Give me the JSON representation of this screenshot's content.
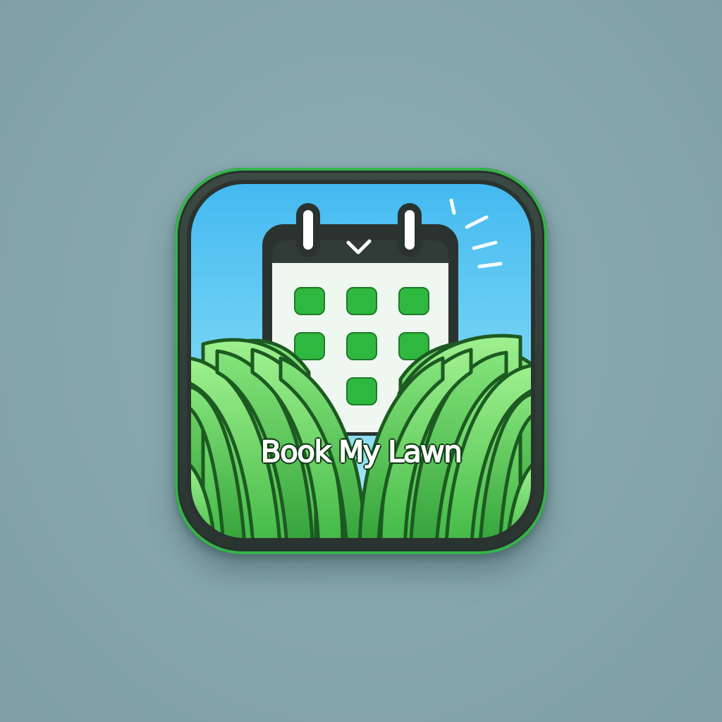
{
  "app": {
    "name": "Book My Lawn"
  },
  "icons": {
    "calendar": "calendar-icon",
    "checkmark": "check-icon",
    "grass": "grass-icon",
    "sparkle": "sparkle-icon"
  },
  "colors": {
    "background": "#87a7ae",
    "sky_top": "#4fc2f2",
    "sky_bottom": "#a9e6f6",
    "grass_light": "#7ee07a",
    "grass_dark": "#2f9a36",
    "calendar_cell": "#2fb83f",
    "frame": "#2b3330"
  }
}
